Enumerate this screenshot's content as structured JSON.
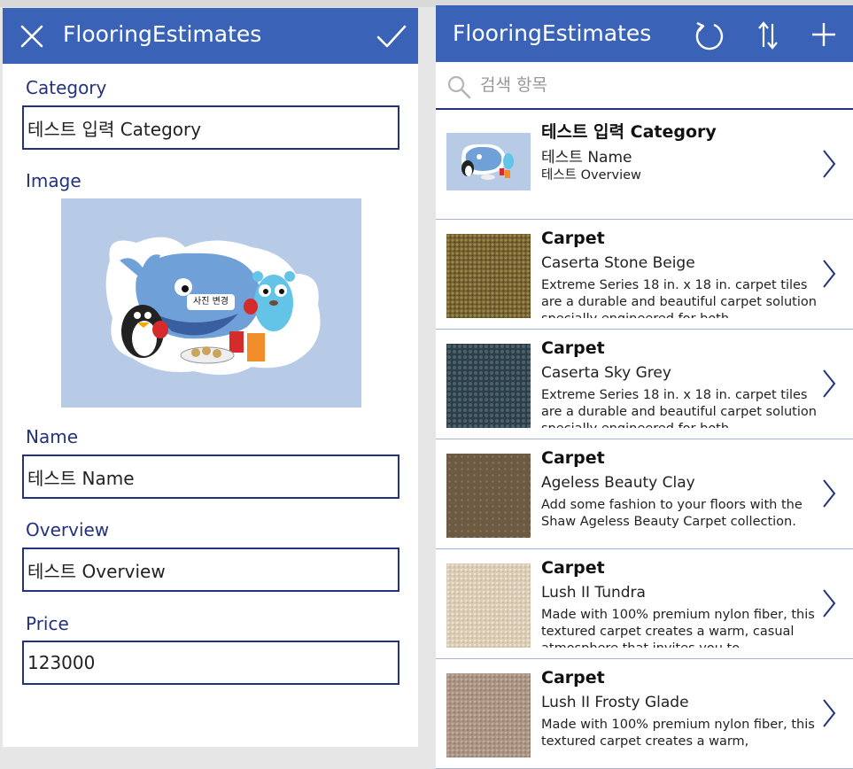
{
  "edit_form": {
    "title": "FlooringEstimates",
    "fields": {
      "category": {
        "label": "Category",
        "value": "테스트 입력 Category"
      },
      "image": {
        "label": "Image",
        "change_photo_label": "사진 변경"
      },
      "name": {
        "label": "Name",
        "value": "테스트 Name"
      },
      "overview": {
        "label": "Overview",
        "value": "테스트 Overview"
      },
      "price": {
        "label": "Price",
        "value": "123000"
      }
    }
  },
  "browse": {
    "title": "FlooringEstimates",
    "search_placeholder": "검색 항목",
    "items": [
      {
        "category": "테스트 입력 Category",
        "name": "테스트 Name",
        "overview": "테스트 Overview",
        "thumb": "sample-mascot-image"
      },
      {
        "category": "Carpet",
        "name": "Caserta Stone Beige",
        "overview": "Extreme Series 18 in. x 18 in. carpet tiles are a durable and beautiful carpet solution specially engineered for both",
        "thumb": "carpet-stone-beige"
      },
      {
        "category": "Carpet",
        "name": "Caserta Sky Grey",
        "overview": "Extreme Series 18 in. x 18 in. carpet tiles are a durable and beautiful carpet solution specially engineered for both",
        "thumb": "carpet-sky-grey"
      },
      {
        "category": "Carpet",
        "name": "Ageless Beauty Clay",
        "overview": "Add some fashion to your floors with the Shaw Ageless Beauty Carpet collection.",
        "thumb": "carpet-clay"
      },
      {
        "category": "Carpet",
        "name": "Lush II Tundra",
        "overview": "Made with 100% premium nylon fiber, this textured carpet creates a warm, casual atmosphere that invites you to",
        "thumb": "carpet-tundra"
      },
      {
        "category": "Carpet",
        "name": "Lush II Frosty Glade",
        "overview": "Made with 100% premium nylon fiber, this textured carpet creates a warm,",
        "thumb": "carpet-frosty-glade"
      }
    ]
  },
  "colors": {
    "header_blue": "#3a63b8",
    "label_navy": "#23327e",
    "divider": "#a7b1d4"
  }
}
